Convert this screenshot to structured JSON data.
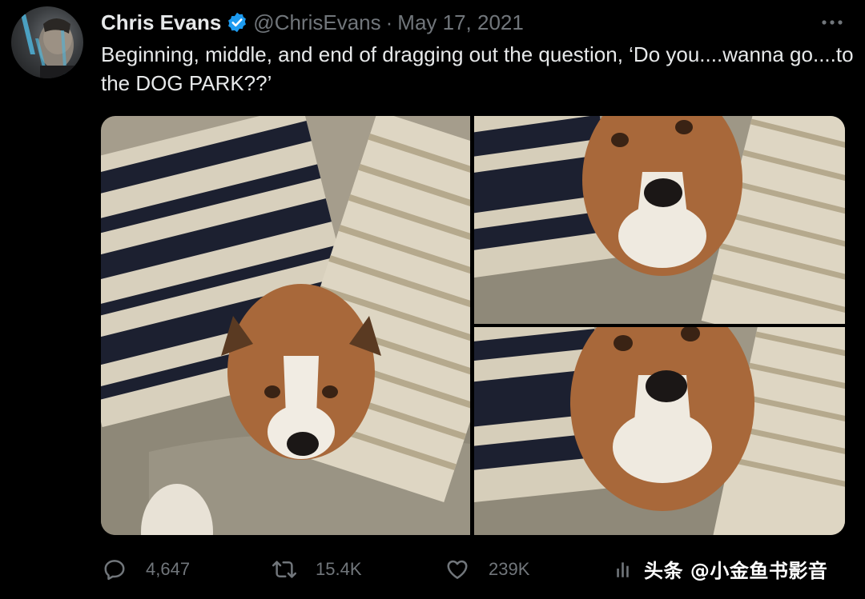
{
  "author": {
    "name": "Chris Evans",
    "handle": "@ChrisEvans",
    "separator": "·",
    "date": "May 17, 2021",
    "verified": true,
    "verified_color": "#1d9bf0"
  },
  "tweet": {
    "text": "Beginning, middle, and end of dragging out the question, ‘Do you....wanna go....to the DOG PARK??’"
  },
  "media": {
    "photo_count": 3,
    "subject": "dog on couch between pillows"
  },
  "actions": {
    "replies": "4,647",
    "retweets": "15.4K",
    "likes": "239K"
  },
  "watermark": {
    "text": "头条 @小金鱼书影音"
  },
  "icons": {
    "more": "more-icon",
    "reply": "reply-icon",
    "retweet": "retweet-icon",
    "like": "heart-icon",
    "views": "bar-chart-icon",
    "verified": "verified-badge-icon"
  },
  "colors": {
    "background": "#000000",
    "text_primary": "#e7e9ea",
    "text_secondary": "#71767b",
    "accent": "#1d9bf0"
  }
}
